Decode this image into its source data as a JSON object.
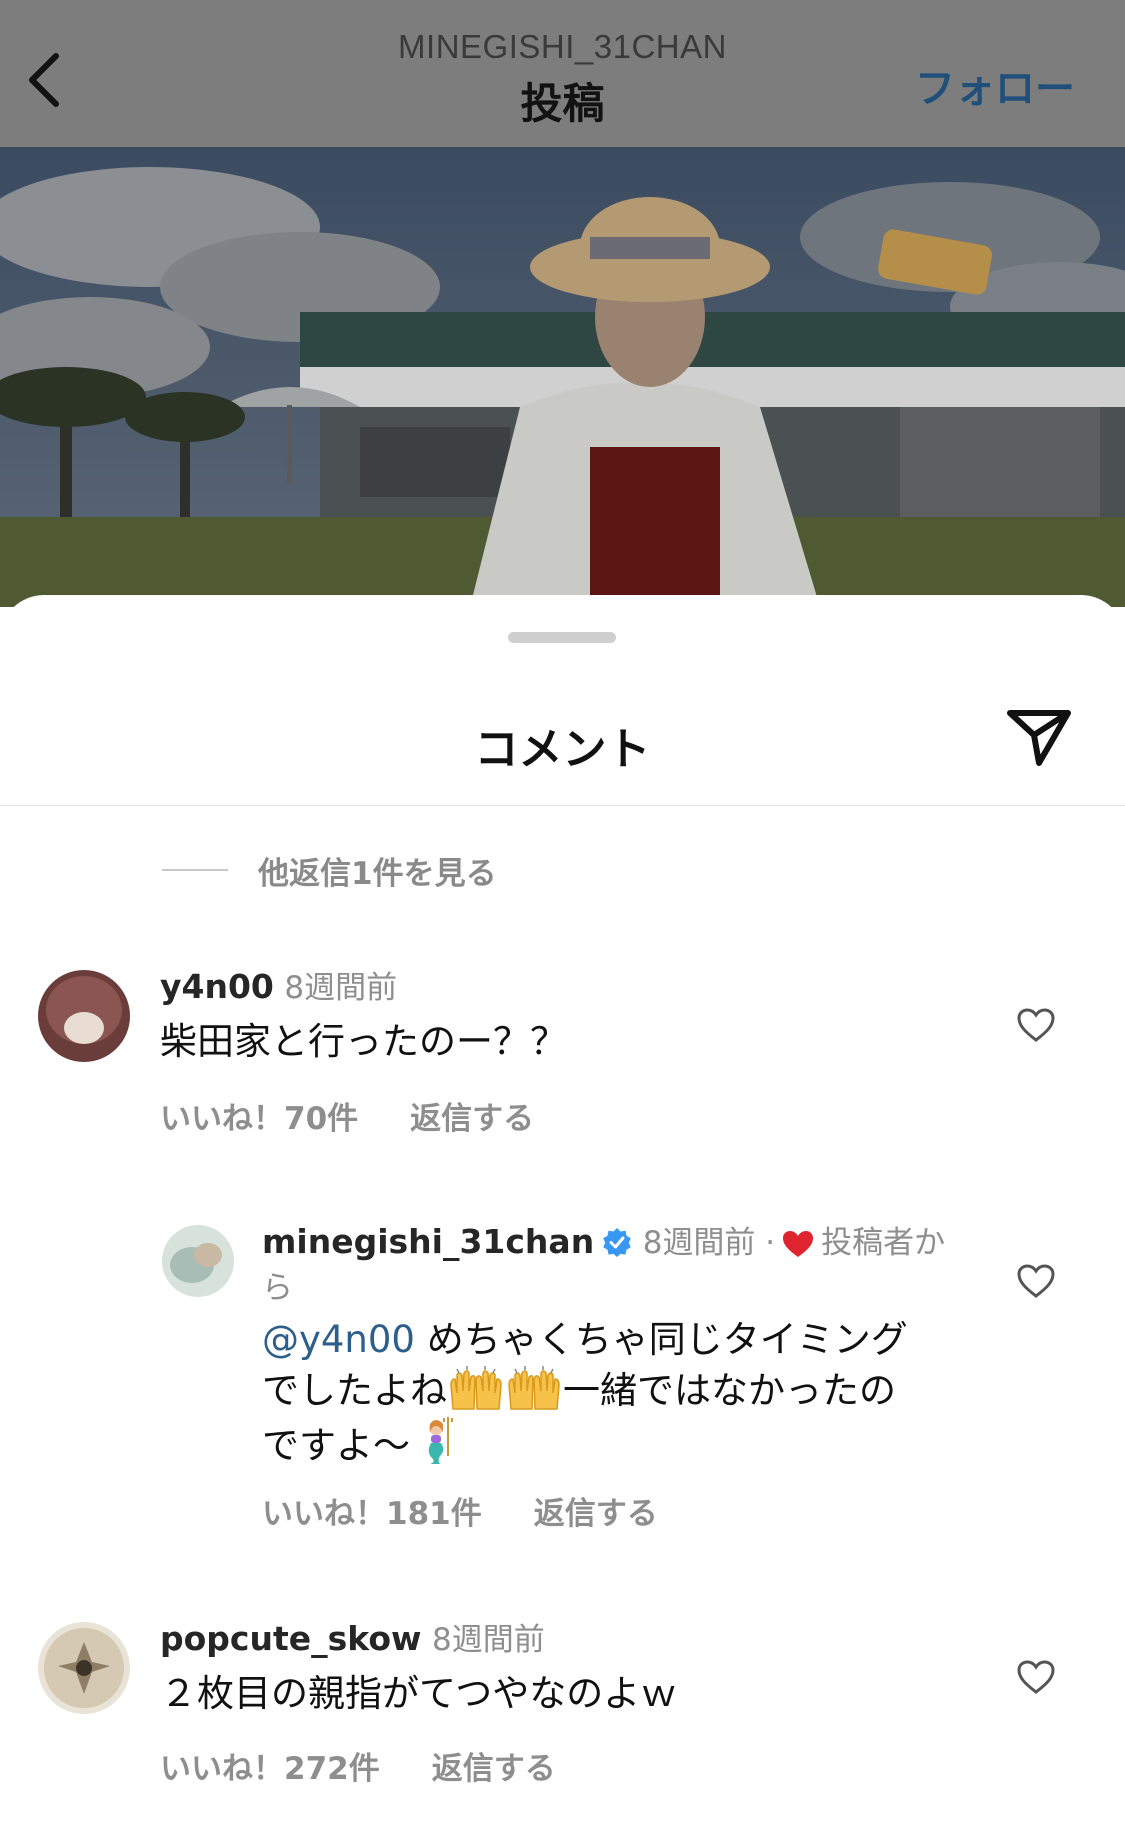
{
  "header": {
    "username": "MINEGISHI_31CHAN",
    "title": "投稿",
    "follow_label": "フォロー"
  },
  "sheet": {
    "title": "コメント",
    "view_replies": "他返信1件を見る"
  },
  "comments": [
    {
      "username": "y4n00",
      "time": "8週間前",
      "text": "柴田家と行ったのー？？",
      "likes": "いいね！70件",
      "reply": "返信する"
    },
    {
      "username": "minegishi_31chan",
      "verified": true,
      "time": "8週間前",
      "author_like_label": "投稿者から",
      "mention": "@y4n00",
      "text_line1": " めちゃくちゃ同じタイミング",
      "text_line2a": "でしたよね",
      "text_line2b": "一緒ではなかったの",
      "text_line3": "ですよ〜",
      "likes": "いいね！181件",
      "reply": "返信する"
    },
    {
      "username": "popcute_skow",
      "time": "8週間前",
      "text": "２枚目の親指がてつやなのよｗ",
      "likes": "いいね！272件",
      "reply": "返信する"
    }
  ],
  "colors": {
    "header_bg": "#7d7d7d",
    "follow": "#1f4f7a",
    "mention": "#2d5f8c",
    "heart_red": "#e0242f",
    "verified_blue": "#3897f0"
  },
  "icons": [
    "back-chevron-icon",
    "share-send-icon",
    "heart-outline-icon",
    "verified-badge-icon",
    "red-heart-icon",
    "raised-hands-emoji",
    "mermaid-emoji"
  ]
}
